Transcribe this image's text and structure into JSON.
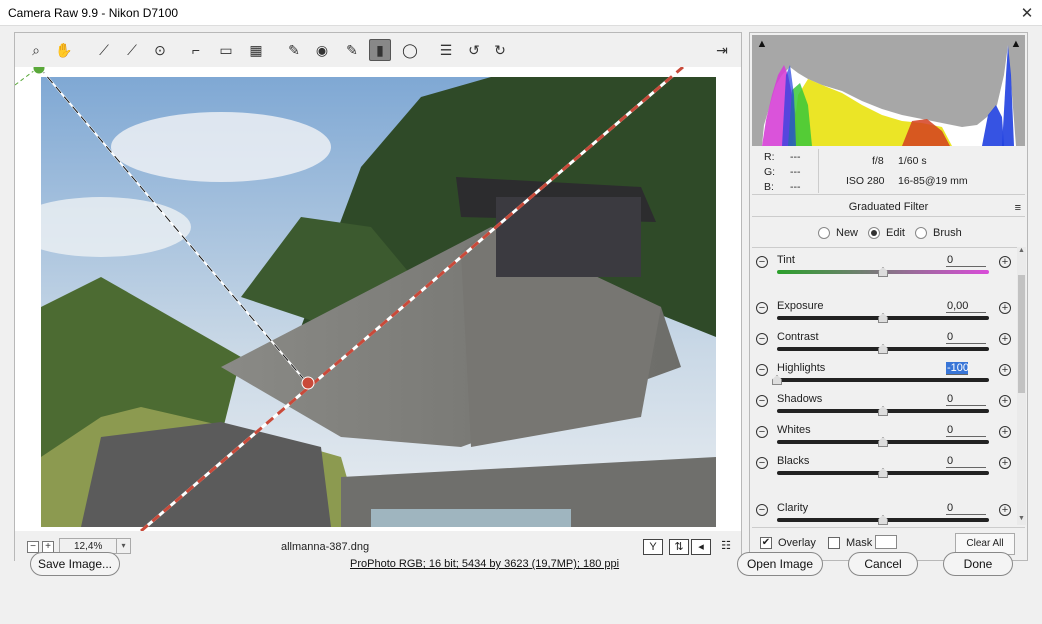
{
  "window": {
    "title": "Camera Raw 9.9  -  Nikon D7100",
    "close_glyph": "✕"
  },
  "toolbar": {
    "tools": [
      {
        "name": "zoom-tool",
        "glyph": "⌕"
      },
      {
        "name": "hand-tool",
        "glyph": "✋"
      },
      {
        "name": "white-balance-tool",
        "glyph": "⟋"
      },
      {
        "name": "color-sampler-tool",
        "glyph": "⟋"
      },
      {
        "name": "targeted-adjustment-tool",
        "glyph": "⊙"
      },
      {
        "name": "crop-tool",
        "glyph": "⌐"
      },
      {
        "name": "straighten-tool",
        "glyph": "▭"
      },
      {
        "name": "transform-tool",
        "glyph": "▦"
      },
      {
        "name": "spot-removal-tool",
        "glyph": "✎"
      },
      {
        "name": "red-eye-tool",
        "glyph": "◉"
      },
      {
        "name": "adjustment-brush-tool",
        "glyph": "✎"
      },
      {
        "name": "graduated-filter-tool",
        "glyph": "▮"
      },
      {
        "name": "radial-filter-tool",
        "glyph": "◯"
      },
      {
        "name": "preferences-tool",
        "glyph": "☰"
      },
      {
        "name": "rotate-ccw-tool",
        "glyph": "↺"
      },
      {
        "name": "rotate-cw-tool",
        "glyph": "↻"
      }
    ],
    "fullscreen_glyph": "⇥"
  },
  "statusbar": {
    "zoom_out": "−",
    "zoom_in": "+",
    "zoom_value": "12,4%",
    "zoom_arrow": "▾",
    "filename": "allmanna-387.dng",
    "view_y": "Y",
    "view_swap": "⇅",
    "view_copy": "◂",
    "view_prefs": "☷"
  },
  "info": {
    "r_label": "R:",
    "r_value": "---",
    "g_label": "G:",
    "g_value": "---",
    "b_label": "B:",
    "b_value": "---",
    "aperture": "f/8",
    "shutter": "1/60 s",
    "iso": "ISO 280",
    "lens": "16-85@19 mm"
  },
  "panel": {
    "title": "Graduated Filter",
    "menu_glyph": "≡",
    "modes": [
      {
        "label": "New",
        "selected": false
      },
      {
        "label": "Edit",
        "selected": true
      },
      {
        "label": "Brush",
        "selected": false
      }
    ]
  },
  "sliders": [
    {
      "label": "Tint",
      "value": "0",
      "level": 0.5,
      "style": "tint"
    },
    {
      "label": "Exposure",
      "value": "0,00",
      "level": 0.5,
      "style": "plain"
    },
    {
      "label": "Contrast",
      "value": "0",
      "level": 0.5,
      "style": "plain"
    },
    {
      "label": "Highlights",
      "value": "-100",
      "level": 0.0,
      "style": "plain",
      "selected": true
    },
    {
      "label": "Shadows",
      "value": "0",
      "level": 0.5,
      "style": "plain"
    },
    {
      "label": "Whites",
      "value": "0",
      "level": 0.5,
      "style": "plain"
    },
    {
      "label": "Blacks",
      "value": "0",
      "level": 0.5,
      "style": "plain"
    },
    {
      "label": "Clarity",
      "value": "0",
      "level": 0.5,
      "style": "plain"
    }
  ],
  "overlay_row": {
    "overlay_label": "Overlay",
    "overlay_checked": true,
    "mask_label": "Mask",
    "mask_checked": false,
    "clear_all": "Clear All"
  },
  "bottom": {
    "save_image": "Save Image...",
    "workflow": "ProPhoto RGB; 16 bit; 5434 by 3623 (19,7MP); 180 ppi",
    "open_image": "Open Image",
    "cancel": "Cancel",
    "done": "Done"
  },
  "colors": {
    "accent": "#3875d7",
    "filter_red": "#c94a3a",
    "filter_green": "#5aa83a"
  }
}
